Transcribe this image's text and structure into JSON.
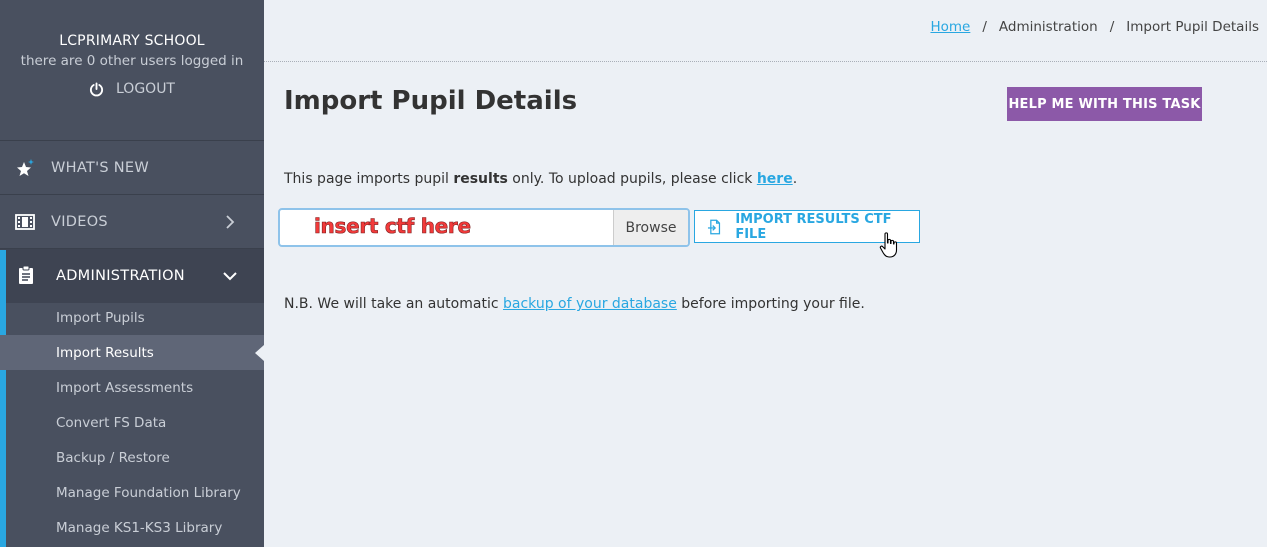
{
  "sidebar": {
    "school_name": "LCPRIMARY SCHOOL",
    "users_logged_in": "there are 0 other users logged in",
    "logout_label": "LOGOUT",
    "menu": [
      {
        "label": "WHAT'S NEW",
        "icon": "star-sparkle-icon"
      },
      {
        "label": "VIDEOS",
        "icon": "film-icon",
        "chevron": "chevron-right-icon"
      },
      {
        "label": "ADMINISTRATION",
        "icon": "clipboard-icon",
        "chevron": "chevron-down-icon"
      }
    ],
    "submenu": [
      {
        "label": "Import Pupils"
      },
      {
        "label": "Import Results",
        "current": true
      },
      {
        "label": "Import Assessments"
      },
      {
        "label": "Convert FS Data"
      },
      {
        "label": "Backup / Restore"
      },
      {
        "label": "Manage Foundation Library"
      },
      {
        "label": "Manage KS1-KS3 Library"
      }
    ]
  },
  "breadcrumb": {
    "home": "Home",
    "separator": "/",
    "admin": "Administration",
    "current": "Import Pupil Details"
  },
  "page": {
    "title": "Import Pupil Details",
    "help_button": "HELP ME WITH THIS TASK",
    "intro": {
      "part1": "This page imports pupil ",
      "bold": "results",
      "part2": " only. To upload pupils, please click ",
      "link": "here",
      "part3": "."
    },
    "file_input_annotation": "insert ctf here",
    "browse_label": "Browse",
    "import_button": "IMPORT RESULTS CTF FILE",
    "nb": {
      "part1": "N.B. We will take an automatic ",
      "link": "backup of your database",
      "part2": " before importing your file."
    }
  },
  "colors": {
    "sidebar_bg": "#49505f",
    "accent_blue": "#29a7e1",
    "help_purple": "#8c59a8",
    "annotation_red": "#f23a3a",
    "content_bg": "#ecf0f5"
  }
}
